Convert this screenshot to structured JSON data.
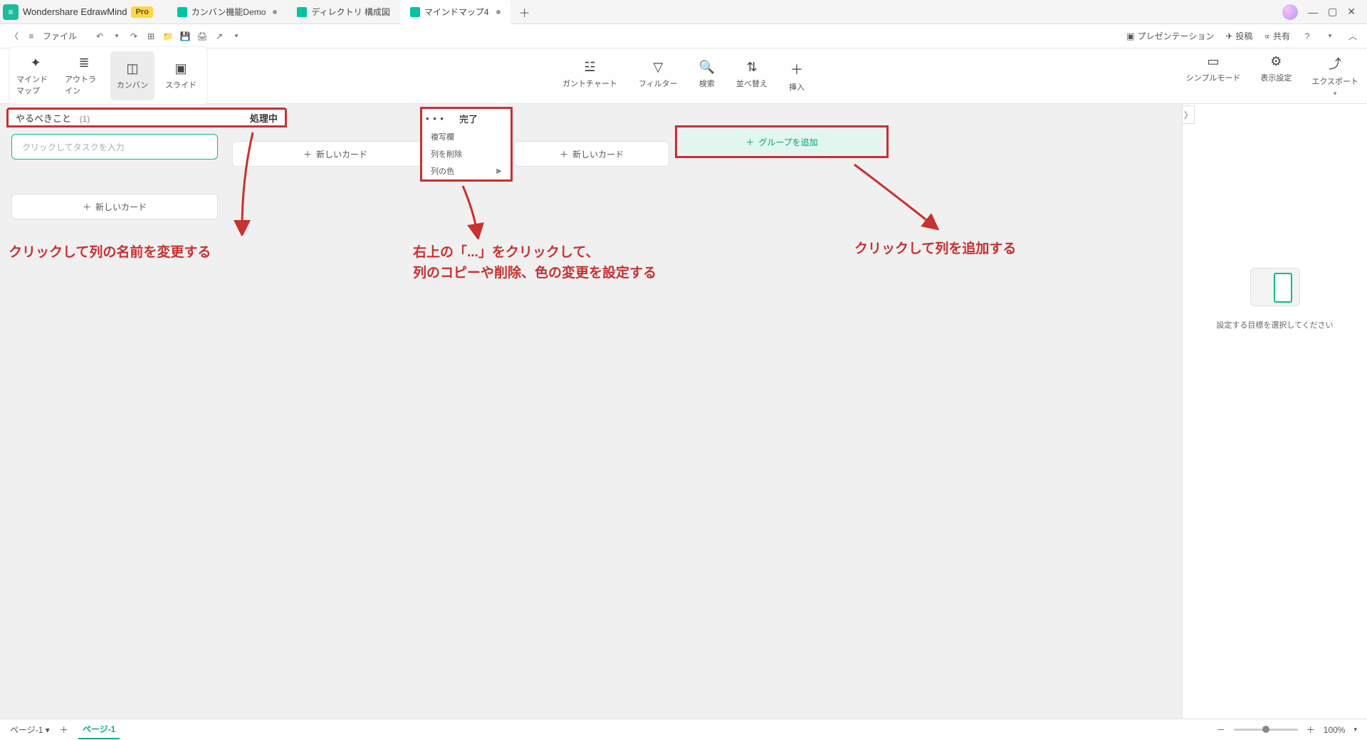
{
  "app": {
    "name": "Wondershare EdrawMind",
    "badge": "Pro"
  },
  "tabs": [
    {
      "label": "カンバン機能Demo",
      "dirty": true
    },
    {
      "label": "ディレクトリ 構成図",
      "dirty": false
    },
    {
      "label": "マインドマップ4",
      "dirty": true,
      "active": true
    }
  ],
  "menubar": {
    "file": "ファイル",
    "right": {
      "presentation": "プレゼンテーション",
      "post": "投稿",
      "share": "共有"
    }
  },
  "views": {
    "mindmap": "マインドマップ",
    "outline": "アウトライン",
    "kanban": "カンバン",
    "slide": "スライド"
  },
  "ribbon_center": {
    "gantt": "ガントチャート",
    "filter": "フィルター",
    "search": "検索",
    "sort": "並べ替え",
    "insert": "挿入"
  },
  "ribbon_right": {
    "simple": "シンプルモード",
    "display": "表示設定",
    "export": "エクスポート"
  },
  "kanban": {
    "col1_title": "やるべきこと",
    "col1_count": "(1)",
    "col1_status": "処理中",
    "task_placeholder": "クリックしてタスクを入力",
    "add_card": "新しいカード",
    "col_done": "完了",
    "ctx_copy": "複写欄",
    "ctx_delete": "列を削除",
    "ctx_color": "列の色",
    "add_group": "グループを追加"
  },
  "annotations": {
    "a1": "クリックして列の名前を変更する",
    "a2_l1": "右上の「...」をクリックして、",
    "a2_l2": "列のコピーや削除、色の変更を設定する",
    "a3": "クリックして列を追加する"
  },
  "right_panel": {
    "placeholder": "設定する目標を選択してください"
  },
  "statusbar": {
    "page_label": "ページ-1",
    "page_tab": "ページ-1",
    "zoom": "100%"
  }
}
